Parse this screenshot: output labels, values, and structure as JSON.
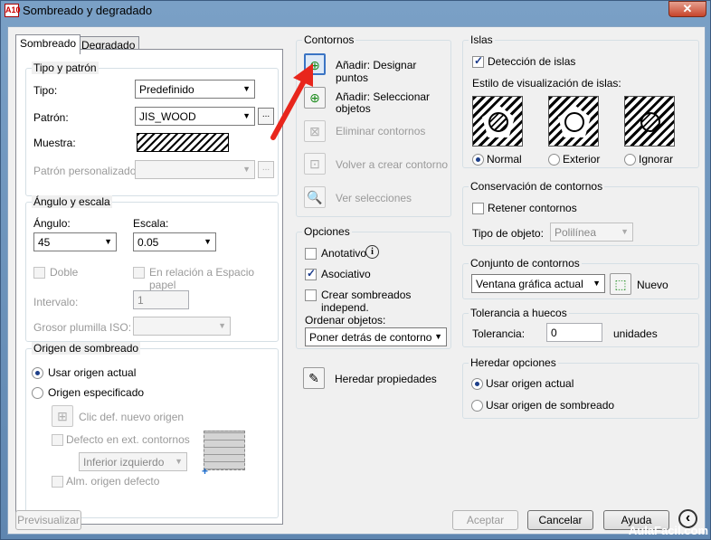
{
  "window": {
    "title": "Sombreado y degradado",
    "app_icon": "A10",
    "close": "✕"
  },
  "tabs": [
    {
      "label": "Sombreado"
    },
    {
      "label": "Degradado"
    }
  ],
  "tipo_patron": {
    "group": "Tipo y patrón",
    "tipo_label": "Tipo:",
    "tipo_value": "Predefinido",
    "patron_label": "Patrón:",
    "patron_value": "JIS_WOOD",
    "patron_browse": "...",
    "muestra_label": "Muestra:",
    "patron_pers_label": "Patrón personalizado:",
    "patron_pers_browse": "..."
  },
  "angulo_escala": {
    "group": "Ángulo y escala",
    "angulo_label": "Ángulo:",
    "angulo_value": "45",
    "escala_label": "Escala:",
    "escala_value": "0.05",
    "doble_label": "Doble",
    "relacion_label": "En relación a Espacio papel",
    "intervalo_label": "Intervalo:",
    "intervalo_value": "1",
    "grosor_label": "Grosor plumilla ISO:"
  },
  "origen": {
    "group": "Origen de sombreado",
    "usar_actual": "Usar origen actual",
    "especificado": "Origen especificado",
    "clic_def": "Clic def. nuevo origen",
    "defecto_ext": "Defecto en ext. contornos",
    "inferior_izq": "Inferior izquierdo",
    "alm_origen": "Alm. origen defecto"
  },
  "contornos": {
    "group": "Contornos",
    "add_points": "Añadir: Designar puntos",
    "add_objects": "Añadir: Seleccionar objetos",
    "remove": "Eliminar contornos",
    "recreate": "Volver a crear contorno",
    "view": "Ver selecciones"
  },
  "opciones": {
    "group": "Opciones",
    "anotativo": "Anotativo",
    "asociativo": "Asociativo",
    "crear_indep": "Crear sombreados independ.",
    "ordenar_label": "Ordenar objetos:",
    "ordenar_value": "Poner detrás de contorno"
  },
  "heredar_prop": "Heredar propiedades",
  "islas": {
    "group": "Islas",
    "deteccion": "Detección de islas",
    "estilo_label": "Estilo de visualización de islas:",
    "normal": "Normal",
    "exterior": "Exterior",
    "ignorar": "Ignorar"
  },
  "conservacion": {
    "group": "Conservación de contornos",
    "retener": "Retener contornos",
    "tipo_label": "Tipo de objeto:",
    "tipo_value": "Polilínea"
  },
  "conjunto": {
    "group": "Conjunto de contornos",
    "value": "Ventana gráfica actual",
    "nuevo": "Nuevo"
  },
  "tolerancia": {
    "group": "Tolerancia a huecos",
    "label": "Tolerancia:",
    "value": "0",
    "units": "unidades"
  },
  "heredar_opciones": {
    "group": "Heredar opciones",
    "usar_actual": "Usar origen actual",
    "usar_sombreado": "Usar origen de sombreado"
  },
  "buttons": {
    "previsualizar": "Previsualizar",
    "aceptar": "Aceptar",
    "cancelar": "Cancelar",
    "ayuda": "Ayuda",
    "collapse": "‹"
  },
  "watermark": "AulaFacil.com"
}
